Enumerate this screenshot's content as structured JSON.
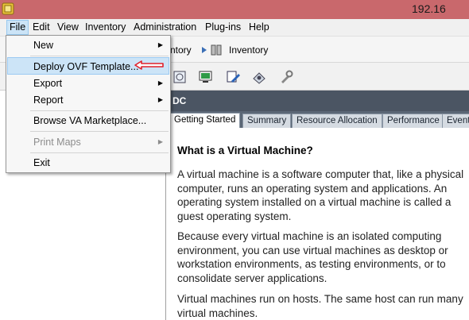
{
  "window": {
    "title": "192.16"
  },
  "menubar": {
    "items": [
      "File",
      "Edit",
      "View",
      "Inventory",
      "Administration",
      "Plug-ins",
      "Help"
    ]
  },
  "breadcrumb": {
    "part1": "ntory",
    "part2": "Inventory"
  },
  "toolbar": {
    "icons": [
      "console-icon",
      "vm-poweron-icon",
      "edit-settings-icon",
      "snapshot-icon",
      "tools-icon"
    ]
  },
  "panel": {
    "header": "DC"
  },
  "tabs": [
    "Getting Started",
    "Summary",
    "Resource Allocation",
    "Performance",
    "Event"
  ],
  "content": {
    "heading": "What is a Virtual Machine?",
    "p1": "A virtual machine is a software computer that, like a physical computer, runs an operating system and applications. An operating system installed on a virtual machine is called a guest operating system.",
    "p2": "Because every virtual machine is an isolated computing environment, you can use virtual machines as desktop or workstation environments, as testing environments, or to consolidate server applications.",
    "p3": "Virtual machines run on hosts. The same host can run many virtual machines."
  },
  "file_menu": {
    "new": "New",
    "deploy_ovf": "Deploy OVF Template...",
    "export": "Export",
    "report": "Report",
    "browse_va": "Browse VA Marketplace...",
    "print_maps": "Print Maps",
    "exit": "Exit"
  },
  "colors": {
    "titlebar": "#c9686c",
    "menu_highlight": "#cce4f7",
    "annotation_arrow": "#e0202a",
    "header_strip": "#4b5563"
  }
}
